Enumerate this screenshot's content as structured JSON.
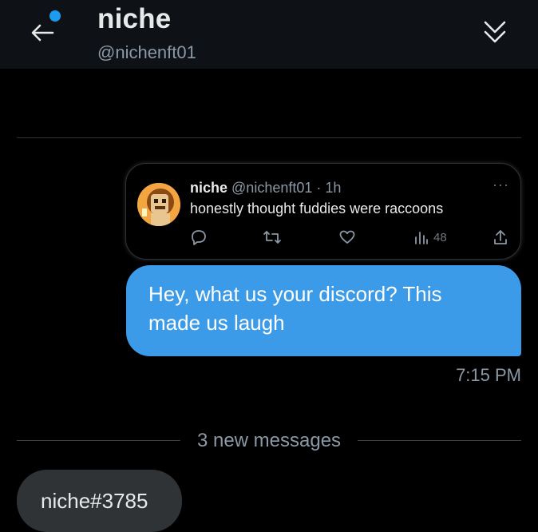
{
  "header": {
    "title": "niche",
    "handle": "@nichenft01"
  },
  "tweet": {
    "name": "niche",
    "handle_time": "@nichenft01 · 1h",
    "text": "honestly thought fuddies were raccoons",
    "views": "48",
    "more": "···"
  },
  "messages": {
    "outgoing_text": "Hey, what us your discord? This made us laugh",
    "outgoing_time": "7:15 PM",
    "new_messages_label": "3 new messages",
    "incoming_text": "niche#3785"
  },
  "colors": {
    "accent": "#1d9bf0",
    "outgoing_bubble": "#3b9be9",
    "incoming_bubble": "#2f3336",
    "header_bg": "#0e1115"
  }
}
